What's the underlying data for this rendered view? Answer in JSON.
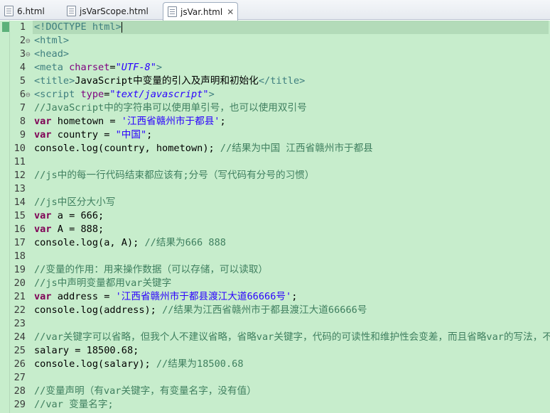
{
  "tabs": [
    {
      "label": "6.html",
      "active": false
    },
    {
      "label": "jsVarScope.html",
      "active": false
    },
    {
      "label": "jsVar.html",
      "active": true
    }
  ],
  "editor": {
    "background": "#c7edcc",
    "lines": [
      {
        "n": "1",
        "fold": "",
        "current": true,
        "segs": [
          [
            "tag",
            "<!DOCTYPE html>"
          ]
        ]
      },
      {
        "n": "2",
        "fold": "⊖",
        "segs": [
          [
            "tag",
            "<html>"
          ]
        ]
      },
      {
        "n": "3",
        "fold": "⊖",
        "segs": [
          [
            "tag",
            "<head>"
          ]
        ]
      },
      {
        "n": "4",
        "fold": "",
        "segs": [
          [
            "tag",
            "<meta "
          ],
          [
            "attr",
            "charset"
          ],
          [
            "pl",
            "="
          ],
          [
            "stri",
            "\"UTF-8\""
          ],
          [
            "tag",
            ">"
          ]
        ]
      },
      {
        "n": "5",
        "fold": "",
        "segs": [
          [
            "tag",
            "<title>"
          ],
          [
            "pl",
            "JavaScript中变量的引入及声明和初始化"
          ],
          [
            "tag",
            "</title>"
          ]
        ]
      },
      {
        "n": "6",
        "fold": "⊖",
        "segs": [
          [
            "tag",
            "<script "
          ],
          [
            "attr",
            "type"
          ],
          [
            "pl",
            "="
          ],
          [
            "stri",
            "\"text/javascript\""
          ],
          [
            "tag",
            ">"
          ]
        ]
      },
      {
        "n": "7",
        "fold": "",
        "segs": [
          [
            "cm",
            "//JavaScript中的字符串可以使用单引号，也可以使用双引号"
          ]
        ]
      },
      {
        "n": "8",
        "fold": "",
        "segs": [
          [
            "kw",
            "var"
          ],
          [
            "pl",
            " hometown = "
          ],
          [
            "str",
            "'江西省赣州市于都县'"
          ],
          [
            "pl",
            ";"
          ]
        ]
      },
      {
        "n": "9",
        "fold": "",
        "segs": [
          [
            "kw",
            "var"
          ],
          [
            "pl",
            " country = "
          ],
          [
            "str",
            "\"中国\""
          ],
          [
            "pl",
            ";"
          ]
        ]
      },
      {
        "n": "10",
        "fold": "",
        "segs": [
          [
            "pl",
            "console.log(country, hometown); "
          ],
          [
            "cm",
            "//结果为中国 江西省赣州市于都县"
          ]
        ]
      },
      {
        "n": "11",
        "fold": "",
        "segs": []
      },
      {
        "n": "12",
        "fold": "",
        "segs": [
          [
            "cm",
            "//js中的每一行代码结束都应该有;分号（写代码有分号的习惯）"
          ]
        ]
      },
      {
        "n": "13",
        "fold": "",
        "segs": []
      },
      {
        "n": "14",
        "fold": "",
        "segs": [
          [
            "cm",
            "//js中区分大小写"
          ]
        ]
      },
      {
        "n": "15",
        "fold": "",
        "segs": [
          [
            "kw",
            "var"
          ],
          [
            "pl",
            " a = 666;"
          ]
        ]
      },
      {
        "n": "16",
        "fold": "",
        "segs": [
          [
            "kw",
            "var"
          ],
          [
            "pl",
            " A = 888;"
          ]
        ]
      },
      {
        "n": "17",
        "fold": "",
        "segs": [
          [
            "pl",
            "console.log(a, A); "
          ],
          [
            "cm",
            "//结果为666 888"
          ]
        ]
      },
      {
        "n": "18",
        "fold": "",
        "segs": []
      },
      {
        "n": "19",
        "fold": "",
        "segs": [
          [
            "cm",
            "//变量的作用：用来操作数据（可以存储，可以读取）"
          ]
        ]
      },
      {
        "n": "20",
        "fold": "",
        "segs": [
          [
            "cm",
            "//js中声明变量都用var关键字"
          ]
        ]
      },
      {
        "n": "21",
        "fold": "",
        "segs": [
          [
            "kw",
            "var"
          ],
          [
            "pl",
            " address = "
          ],
          [
            "str",
            "'江西省赣州市于都县渡江大道66666号'"
          ],
          [
            "pl",
            ";"
          ]
        ]
      },
      {
        "n": "22",
        "fold": "",
        "segs": [
          [
            "pl",
            "console.log(address); "
          ],
          [
            "cm",
            "//结果为江西省赣州市于都县渡江大道66666号"
          ]
        ]
      },
      {
        "n": "23",
        "fold": "",
        "segs": []
      },
      {
        "n": "24",
        "fold": "",
        "segs": [
          [
            "cm",
            "//var关键字可以省略，但我个人不建议省略，省略var关键字，代码的可读性和维护性会变差，而且省略var的写法，不太规范。"
          ]
        ]
      },
      {
        "n": "25",
        "fold": "",
        "segs": [
          [
            "pl",
            "salary = 18500.68;"
          ]
        ]
      },
      {
        "n": "26",
        "fold": "",
        "segs": [
          [
            "pl",
            "console.log(salary); "
          ],
          [
            "cm",
            "//结果为18500.68"
          ]
        ]
      },
      {
        "n": "27",
        "fold": "",
        "segs": []
      },
      {
        "n": "28",
        "fold": "",
        "segs": [
          [
            "cm",
            "//变量声明（有var关键字，有变量名字，没有值）"
          ]
        ]
      },
      {
        "n": "29",
        "fold": "",
        "segs": [
          [
            "cm",
            "//var 变量名字;"
          ]
        ]
      }
    ]
  }
}
